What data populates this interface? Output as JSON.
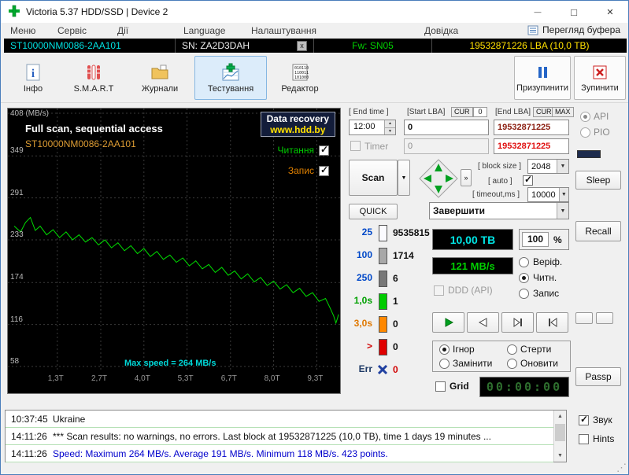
{
  "window": {
    "title": "Victoria 5.37 HDD/SSD | Device 2"
  },
  "menu": {
    "items": [
      "Меню",
      "Сервіс",
      "Дії",
      "Language",
      "Налаштування",
      "Довідка"
    ],
    "buffer_view_label": "Перегляд буфера"
  },
  "device_bar": {
    "model": "ST10000NM0086-2AA101",
    "serial": "SN: ZA2D3DAH",
    "firmware": "Fw: SN05",
    "capacity": "19532871226 LBA (10,0 ТВ)"
  },
  "toolbar": {
    "buttons": [
      {
        "label": "Інфо"
      },
      {
        "label": "S.M.A.R.T"
      },
      {
        "label": "Журнали"
      },
      {
        "label": "Тестування",
        "active": true
      },
      {
        "label": "Редактор"
      }
    ],
    "pause_label": "Призупинити",
    "stop_label": "Зупинити"
  },
  "graph": {
    "title": "Full scan, sequential access",
    "subtitle": "ST10000NM0086-2AA101",
    "badge_line1": "Data recovery",
    "badge_line2": "www.hdd.by",
    "legend_read": "Читання",
    "legend_write": "Запис",
    "max_speed_note": "Max speed = 264 MB/s"
  },
  "chart_data": {
    "type": "line",
    "title": "Full scan, sequential access",
    "series_name": "Read speed",
    "x_unit": "ТВ",
    "xlim": [
      0,
      10
    ],
    "ylim": [
      0,
      408
    ],
    "grid": true,
    "line_color": "#00dd00",
    "max_speed_mbs": 264,
    "avg_speed_mbs": 191,
    "min_speed_mbs": 118,
    "points_count_note": "423 points",
    "y_ticks": [
      {
        "label": "408 (MB/s)",
        "value": 408
      },
      {
        "label": "349",
        "value": 349
      },
      {
        "label": "291",
        "value": 291
      },
      {
        "label": "233",
        "value": 233
      },
      {
        "label": "174",
        "value": 174
      },
      {
        "label": "116",
        "value": 116
      },
      {
        "label": "58",
        "value": 58
      }
    ],
    "x_ticks": [
      {
        "label": "1,3Т",
        "value": 1.33
      },
      {
        "label": "2,7Т",
        "value": 2.67
      },
      {
        "label": "4,0Т",
        "value": 4.0
      },
      {
        "label": "5,3Т",
        "value": 5.33
      },
      {
        "label": "6,7Т",
        "value": 6.67
      },
      {
        "label": "8,0Т",
        "value": 8.0
      },
      {
        "label": "9,3Т",
        "value": 9.33
      }
    ],
    "points": [
      [
        0,
        252
      ],
      [
        0.2,
        244
      ],
      [
        0.35,
        257
      ],
      [
        0.5,
        264
      ],
      [
        0.65,
        246
      ],
      [
        0.8,
        252
      ],
      [
        1,
        240
      ],
      [
        1.2,
        247
      ],
      [
        1.4,
        236
      ],
      [
        1.6,
        244
      ],
      [
        1.8,
        233
      ],
      [
        2,
        240
      ],
      [
        2.2,
        230
      ],
      [
        2.4,
        236
      ],
      [
        2.6,
        226
      ],
      [
        2.8,
        233
      ],
      [
        3,
        222
      ],
      [
        3.2,
        229
      ],
      [
        3.4,
        218
      ],
      [
        3.6,
        225
      ],
      [
        3.8,
        214
      ],
      [
        4,
        221
      ],
      [
        4.2,
        210
      ],
      [
        4.4,
        217
      ],
      [
        4.6,
        206
      ],
      [
        4.8,
        212
      ],
      [
        5,
        202
      ],
      [
        5.2,
        208
      ],
      [
        5.4,
        197
      ],
      [
        5.6,
        204
      ],
      [
        5.8,
        193
      ],
      [
        6,
        199
      ],
      [
        6.2,
        188
      ],
      [
        6.4,
        195
      ],
      [
        6.6,
        184
      ],
      [
        6.8,
        190
      ],
      [
        7,
        179
      ],
      [
        7.2,
        186
      ],
      [
        7.4,
        175
      ],
      [
        7.6,
        181
      ],
      [
        7.8,
        170
      ],
      [
        8,
        176
      ],
      [
        8.2,
        165
      ],
      [
        8.4,
        171
      ],
      [
        8.6,
        160
      ],
      [
        8.8,
        166
      ],
      [
        9,
        155
      ],
      [
        9.2,
        160
      ],
      [
        9.4,
        148
      ],
      [
        9.6,
        152
      ],
      [
        9.75,
        138
      ],
      [
        9.85,
        128
      ],
      [
        9.92,
        118
      ],
      [
        9.97,
        125
      ],
      [
        10,
        130
      ]
    ]
  },
  "controls": {
    "end_time_label": "[ End time ]",
    "start_lba_label": "[Start LBA]",
    "end_lba_label": "[End LBA]",
    "cur_button": "CUR",
    "max_button": "MAX",
    "cur_value": "0",
    "end_time_value": "12:00",
    "start_lba_value": "0",
    "end_lba_value": "19532871225",
    "timer_label": "Timer",
    "timer_value": "0",
    "end_lba_value2": "19532871225",
    "scan_button": "Scan",
    "block_size_label": "[ block size ]",
    "block_size_value": "2048",
    "auto_label": "[ auto ]",
    "timeout_label": "[ timeout,ms ]",
    "timeout_value": "10000",
    "quick_button": "QUICK",
    "action_select": "Завершити"
  },
  "stats": {
    "rows": [
      {
        "label": "25",
        "count": "9535815",
        "label_color": "#0048c8",
        "bar_color": "#fbfbff"
      },
      {
        "label": "100",
        "count": "1714",
        "label_color": "#0048c8",
        "bar_color": "#a8a8a8"
      },
      {
        "label": "250",
        "count": "6",
        "label_color": "#0048c8",
        "bar_color": "#787878"
      },
      {
        "label": "1,0s",
        "count": "1",
        "label_color": "#00a000",
        "bar_color": "#00cc00"
      },
      {
        "label": "3,0s",
        "count": "0",
        "label_color": "#e07800",
        "bar_color": "#ff8800"
      },
      {
        "label": ">",
        "count": "0",
        "label_color": "#d00000",
        "bar_color": "#e00000"
      },
      {
        "label": "Err",
        "count": "0",
        "label_color": "#1e3a66",
        "bar_color": "x-icon"
      }
    ]
  },
  "status": {
    "capacity_display": "10,00 ТВ",
    "percent_value": "100",
    "percent_sign": "%",
    "speed_display": "121 MB/s",
    "mode_options": [
      "Веріф.",
      "Читн.",
      "Запис"
    ],
    "mode_selected": "Читн.",
    "ddd_label": "DDD (API)",
    "action_options": [
      "Ігнор",
      "Стерти",
      "Замінити",
      "Оновити"
    ],
    "action_selected": "Ігнор",
    "grid_label": "Grid",
    "timer_display": "00:00:00"
  },
  "right_panel": {
    "api_label": "API",
    "pio_label": "PIO",
    "sleep_button": "Sleep",
    "recall_button": "Recall",
    "passp_button": "Passp",
    "sound_label": "Звук",
    "hints_label": "Hints"
  },
  "log": {
    "rows": [
      {
        "time": "10:37:45",
        "text": "Ukraine"
      },
      {
        "time": "14:11:26",
        "text": "*** Scan results: no warnings, no errors. Last block at 19532871225 (10,0 ТВ), time 1 days 19 minutes ..."
      },
      {
        "time": "14:11:26",
        "text": "Speed: Maximum 264 MB/s. Average 191 MB/s. Minimum 118 MB/s. 423 points."
      }
    ]
  }
}
